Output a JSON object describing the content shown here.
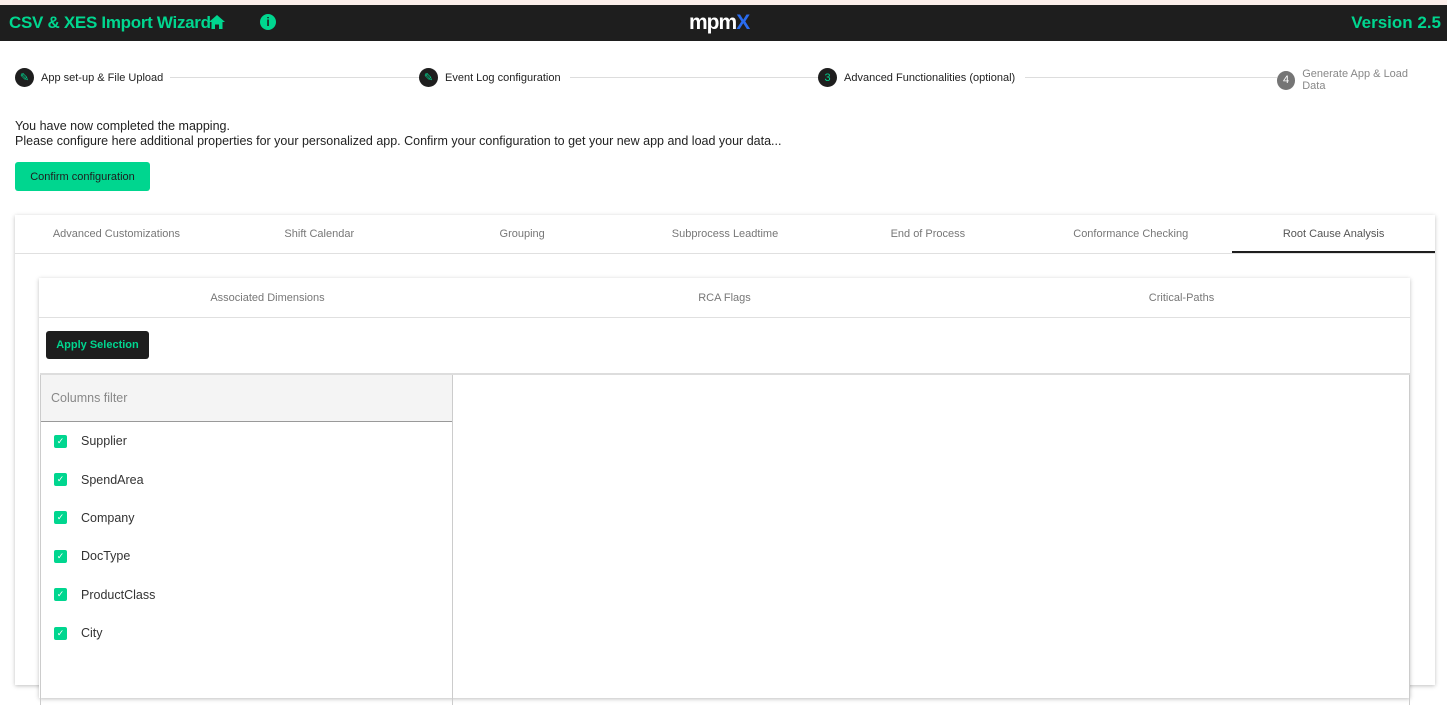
{
  "header": {
    "title": "CSV & XES Import Wizard",
    "logo": "mpmX",
    "version": "Version 2.5",
    "icons": [
      "home-icon",
      "info-icon"
    ]
  },
  "colors": {
    "accent": "#00d68f",
    "dark": "#1e1e1e"
  },
  "stepper": [
    {
      "label": "App set-up & File Upload",
      "state": "done"
    },
    {
      "label": "Event Log configuration",
      "state": "done"
    },
    {
      "num": "3",
      "label": "Advanced Functionalities (optional)",
      "state": "active"
    },
    {
      "num": "4",
      "label": "Generate App & Load Data",
      "state": "pending"
    }
  ],
  "intro": {
    "line1": "You have now completed the mapping.",
    "line2": "Please configure here additional properties for your personalized app. Confirm your configuration to get your new app and load your data..."
  },
  "confirm_label": "Confirm configuration",
  "tabs": [
    "Advanced Customizations",
    "Shift Calendar",
    "Grouping",
    "Subprocess Leadtime",
    "End of Process",
    "Conformance Checking",
    "Root Cause Analysis"
  ],
  "active_tab": "Root Cause Analysis",
  "subtabs": [
    "Associated Dimensions",
    "RCA Flags",
    "Critical-Paths"
  ],
  "apply_label": "Apply Selection",
  "filter_placeholder": "Columns filter",
  "columns": [
    {
      "label": "Supplier",
      "checked": true
    },
    {
      "label": "SpendArea",
      "checked": true
    },
    {
      "label": "Company",
      "checked": true
    },
    {
      "label": "DocType",
      "checked": true
    },
    {
      "label": "ProductClass",
      "checked": true
    },
    {
      "label": "City",
      "checked": true
    }
  ]
}
